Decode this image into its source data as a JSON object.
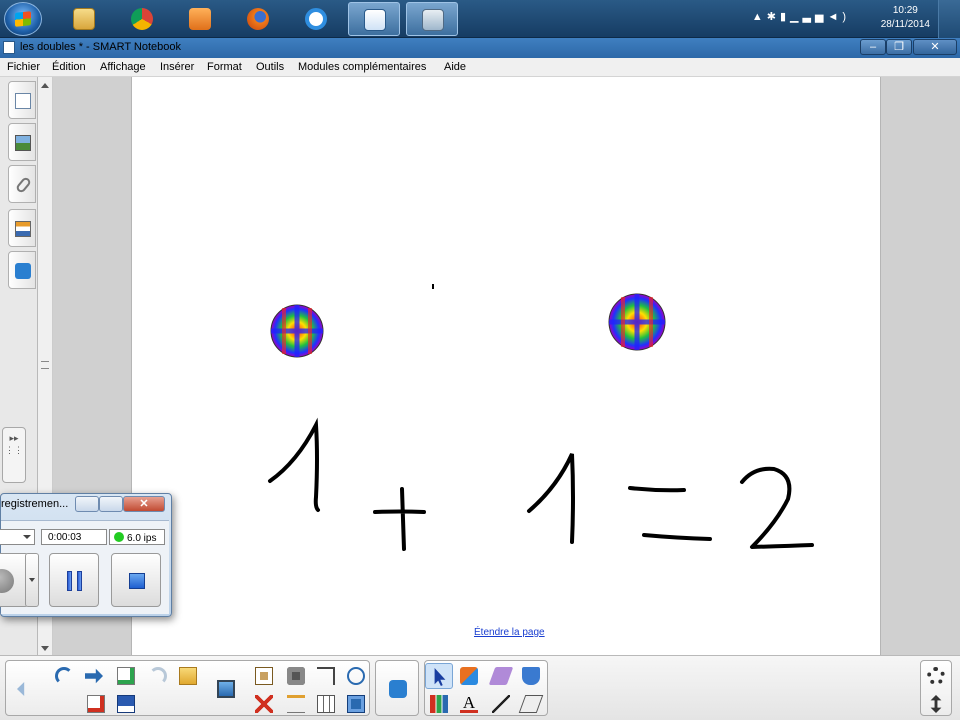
{
  "taskbar": {
    "clock_time": "10:29",
    "clock_date": "28/11/2014",
    "apps": [
      {
        "name": "explorer-icon",
        "color": "#e8c15a"
      },
      {
        "name": "chrome-icon",
        "color": "#2da44e"
      },
      {
        "name": "media-player-icon",
        "color": "#f28c28"
      },
      {
        "name": "firefox-icon",
        "color": "#e56a1e"
      },
      {
        "name": "internet-explorer-icon",
        "color": "#2f8ee0"
      },
      {
        "name": "smart-notebook-icon",
        "color": "#3a7fd0"
      },
      {
        "name": "document-camera-icon",
        "color": "#9fb7cc"
      }
    ]
  },
  "window": {
    "title": "les doubles * - SMART Notebook",
    "minimize_glyph": "‒",
    "maximize_glyph": "❐",
    "close_glyph": "✕"
  },
  "menu": {
    "items": [
      "Fichier",
      "Édition",
      "Affichage",
      "Insérer",
      "Format",
      "Outils",
      "Modules complémentaires",
      "Aide"
    ]
  },
  "page": {
    "extend_link": "Étendre la page"
  },
  "recorder": {
    "title": "registremen...",
    "close_glyph": "✕",
    "elapsed": "0:00:03",
    "fps": "6.0 ips"
  },
  "colors": {
    "accent_blue": "#2d68a8",
    "link_blue": "#1a3ed0",
    "fps_indicator": "#22cc22",
    "ink": "#000000"
  }
}
